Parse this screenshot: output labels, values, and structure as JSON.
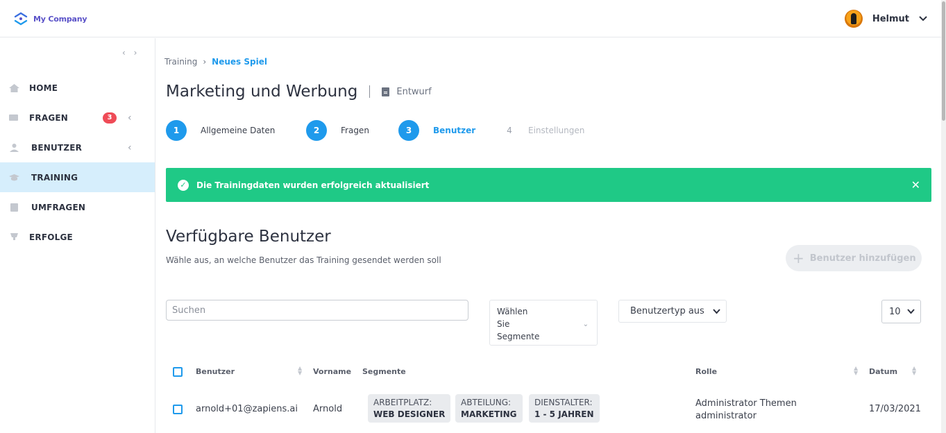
{
  "header": {
    "company": "My Company",
    "user_name": "Helmut"
  },
  "sidebar": {
    "items": [
      {
        "label": "HOME",
        "icon": "home-icon"
      },
      {
        "label": "FRAGEN",
        "icon": "questions-icon",
        "badge": "3"
      },
      {
        "label": "BENUTZER",
        "icon": "user-icon"
      },
      {
        "label": "TRAINING",
        "icon": "training-icon",
        "active": true
      },
      {
        "label": "UMFRAGEN",
        "icon": "survey-icon"
      },
      {
        "label": "ERFOLGE",
        "icon": "trophy-icon"
      }
    ]
  },
  "breadcrumb": {
    "parent": "Training",
    "current": "Neues Spiel"
  },
  "page": {
    "title": "Marketing und Werbung",
    "status": "Entwurf"
  },
  "steps": [
    {
      "num": "1",
      "label": "Allgemeine Daten"
    },
    {
      "num": "2",
      "label": "Fragen"
    },
    {
      "num": "3",
      "label": "Benutzer"
    },
    {
      "num": "4",
      "label": "Einstellungen"
    }
  ],
  "alert": {
    "text": "Die Trainingdaten wurden erfolgreich aktualisiert",
    "color": "#1fc986"
  },
  "section": {
    "title": "Verfügbare Benutzer",
    "subtitle": "Wähle aus, an welche Benutzer das Training gesendet werden soll",
    "add_button": "Benutzer hinzufügen"
  },
  "filters": {
    "search_placeholder": "Suchen",
    "segments_line1": "Wählen",
    "segments_line2": "Sie",
    "segments_line3": "Segmente",
    "user_type": "Benutzertyp aus",
    "page_size": "10"
  },
  "table": {
    "headers": {
      "user": "Benutzer",
      "firstname": "Vorname",
      "segments": "Segmente",
      "role": "Rolle",
      "date": "Datum"
    },
    "rows": [
      {
        "email": "arnold+01@zapiens.ai",
        "firstname": "Arnold",
        "tags": [
          {
            "key": "ARBEITPLATZ:",
            "value": "WEB DESIGNER"
          },
          {
            "key": "ABTEILUNG:",
            "value": "MARKETING"
          },
          {
            "key": "DIENSTALTER:",
            "value": "1 - 5 JAHREN"
          }
        ],
        "role_line1": "Administrator Themen",
        "role_line2": "administrator",
        "date": "17/03/2021"
      }
    ]
  },
  "colors": {
    "accent": "#1f9aec",
    "success": "#1fc986",
    "badge": "#ef4b57"
  }
}
